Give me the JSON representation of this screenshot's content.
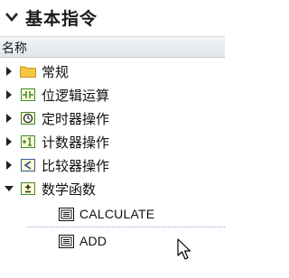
{
  "panel": {
    "title": "基本指令"
  },
  "columns": {
    "name": "名称"
  },
  "tree": [
    {
      "label": "常规",
      "icon": "folder-icon",
      "expanded": false
    },
    {
      "label": "位逻辑运算",
      "icon": "bit-logic-icon",
      "expanded": false
    },
    {
      "label": "定时器操作",
      "icon": "timer-icon",
      "expanded": false
    },
    {
      "label": "计数器操作",
      "icon": "counter-icon",
      "expanded": false
    },
    {
      "label": "比较器操作",
      "icon": "comparator-icon",
      "expanded": false
    },
    {
      "label": "数学函数",
      "icon": "math-functions-icon",
      "expanded": true,
      "children": [
        {
          "label": "CALCULATE",
          "icon": "instruction-box-icon"
        },
        {
          "label": "ADD",
          "icon": "instruction-box-icon"
        }
      ]
    }
  ],
  "colors": {
    "folder": "#f5c542",
    "icon_green": "#3c8a3c",
    "icon_blue": "#2d5d9f",
    "separator": "#8fa9cf"
  }
}
